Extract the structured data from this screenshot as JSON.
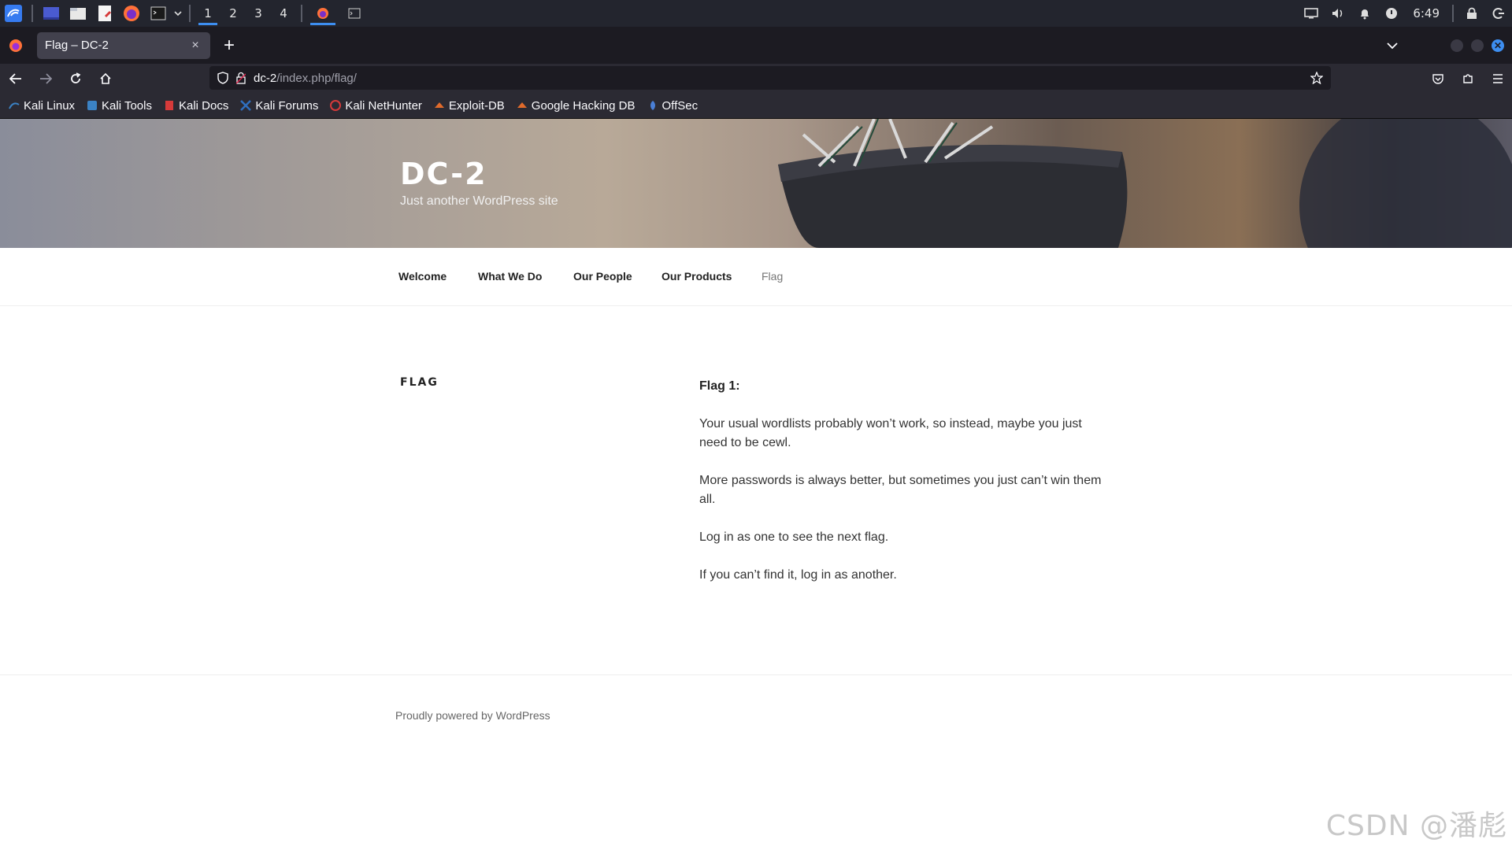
{
  "taskbar": {
    "workspaces": [
      "1",
      "2",
      "3",
      "4"
    ],
    "active_workspace": "1",
    "clock": "6:49"
  },
  "browser": {
    "tab_title": "Flag – DC-2",
    "tab_close": "×",
    "new_tab": "+",
    "url_host": "dc-2",
    "url_path": "/index.php/flag/"
  },
  "bookmarks": [
    {
      "label": "Kali Linux",
      "icon": "kali-dragon-icon",
      "color": "#3b82c4"
    },
    {
      "label": "Kali Tools",
      "icon": "kali-tools-icon",
      "color": "#3b82c4"
    },
    {
      "label": "Kali Docs",
      "icon": "kali-docs-icon",
      "color": "#d63a3a"
    },
    {
      "label": "Kali Forums",
      "icon": "kali-forums-icon",
      "color": "#2f6fbf"
    },
    {
      "label": "Kali NetHunter",
      "icon": "nethunter-icon",
      "color": "#d63a3a"
    },
    {
      "label": "Exploit-DB",
      "icon": "exploit-db-icon",
      "color": "#e06a2b"
    },
    {
      "label": "Google Hacking DB",
      "icon": "ghdb-icon",
      "color": "#e06a2b"
    },
    {
      "label": "OffSec",
      "icon": "offsec-icon",
      "color": "#4a7fd6"
    }
  ],
  "site": {
    "title": "DC-2",
    "description": "Just another WordPress site"
  },
  "menu": [
    "Welcome",
    "What We Do",
    "Our People",
    "Our Products",
    "Flag"
  ],
  "menu_current": "Flag",
  "entry": {
    "title": "FLAG",
    "heading": "Flag 1:",
    "paragraphs": [
      "Your usual wordlists probably won’t work, so instead, maybe you just need to be cewl.",
      "More passwords is always better, but sometimes you just can’t win them all.",
      "Log in as one to see the next flag.",
      "If you can’t find it, log in as another."
    ]
  },
  "footer": {
    "text": "Proudly powered by WordPress"
  },
  "watermark": "CSDN @潘彪",
  "colors": {
    "accent": "#3d8ef0",
    "taskbar_bg": "#23252e",
    "tabstrip_bg": "#1c1b22",
    "toolbar_bg": "#2b2a33"
  }
}
